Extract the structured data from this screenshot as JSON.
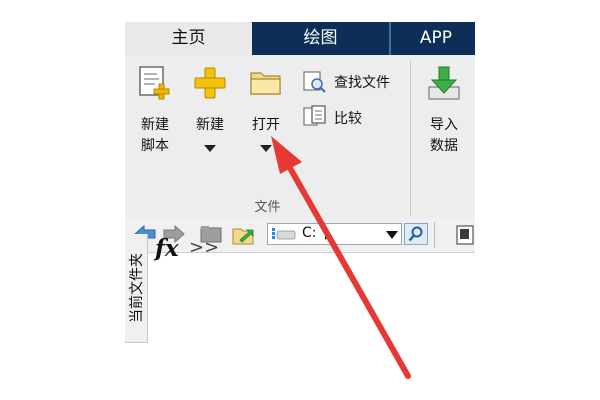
{
  "tabs": {
    "home": "主页",
    "plots": "绘图",
    "apps": "APP"
  },
  "ribbon": {
    "new_script": {
      "line1": "新建",
      "line2": "脚本"
    },
    "new": {
      "label": "新建"
    },
    "open": {
      "label": "打开"
    },
    "find_files": "查找文件",
    "compare": "比较",
    "import_data": {
      "line1": "导入",
      "line2": "数据"
    },
    "group_label": "文件"
  },
  "toolbar": {
    "address_text": "C:"
  },
  "sidebar": {
    "label": "当前文件夹"
  },
  "command_window": {
    "fx_label": "fx",
    "prompt": ">>"
  },
  "colors": {
    "tab_active": "#e9e9e9",
    "tab_bar": "#0d2f57",
    "ribbon_bg": "#ededed",
    "annotation_arrow": "#e53935"
  }
}
